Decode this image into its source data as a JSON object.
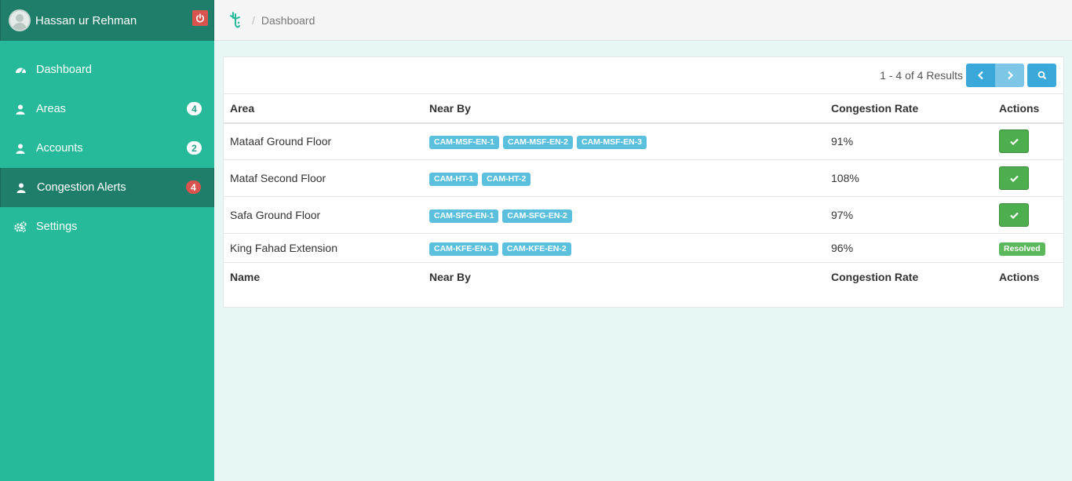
{
  "user": {
    "name": "Hassan ur Rehman"
  },
  "nav": {
    "items": [
      {
        "label": "Dashboard",
        "icon": "dashboard-icon",
        "badge": null,
        "active": false
      },
      {
        "label": "Areas",
        "icon": "user-icon",
        "badge": "4",
        "active": false
      },
      {
        "label": "Accounts",
        "icon": "user-icon",
        "badge": "2",
        "active": false
      },
      {
        "label": "Congestion Alerts",
        "icon": "user-icon",
        "badge": "4",
        "active": true
      },
      {
        "label": "Settings",
        "icon": "gears-icon",
        "badge": null,
        "active": false
      }
    ]
  },
  "breadcrumb": {
    "separator": "/",
    "current": "Dashboard"
  },
  "toolbar": {
    "results": "1 - 4 of 4 Results"
  },
  "table": {
    "headers": [
      "Area",
      "Near By",
      "Congestion Rate",
      "Actions"
    ],
    "footers": [
      "Name",
      "Near By",
      "Congestion Rate",
      "Actions"
    ],
    "rows": [
      {
        "area": "Mataaf Ground Floor",
        "near": [
          "CAM-MSF-EN-1",
          "CAM-MSF-EN-2",
          "CAM-MSF-EN-3"
        ],
        "rate": "91%",
        "action": "check"
      },
      {
        "area": "Mataf Second Floor",
        "near": [
          "CAM-HT-1",
          "CAM-HT-2"
        ],
        "rate": "108%",
        "action": "check"
      },
      {
        "area": "Safa Ground Floor",
        "near": [
          "CAM-SFG-EN-1",
          "CAM-SFG-EN-2"
        ],
        "rate": "97%",
        "action": "check"
      },
      {
        "area": "King Fahad Extension",
        "near": [
          "CAM-KFE-EN-1",
          "CAM-KFE-EN-2"
        ],
        "rate": "96%",
        "action": "Resolved"
      }
    ]
  },
  "colors": {
    "sidebar": "#26b99a",
    "sidebar_dark": "#1f7e69",
    "tag": "#5bc0de",
    "success": "#5cb85c",
    "danger": "#d9534f",
    "primary": "#3aa8d8"
  }
}
